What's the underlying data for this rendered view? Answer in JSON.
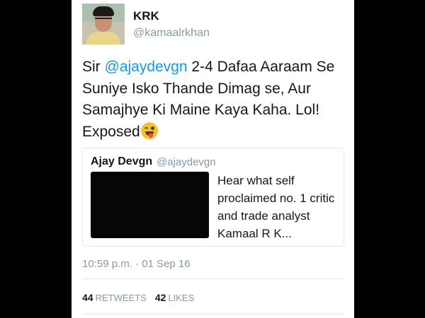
{
  "author": {
    "name": "KRK",
    "handle": "@kamaalrkhan"
  },
  "tweet": {
    "text_prefix": "Sir ",
    "mention": "@ajaydevgn",
    "text_suffix": " 2-4 Dafaa Aaraam Se Suniye Isko Thande Dimag se, Aur Samajhye Ki Maine Kaya Kaha. Lol! Exposed",
    "emoji": "winking-face-with-tongue-icon",
    "mention_color": "#1b95e0"
  },
  "quoted_tweet": {
    "name": "Ajay Devgn",
    "handle": "@ajaydevgn",
    "text": "Hear what self proclaimed no. 1 critic and trade analyst Kamaal R K..."
  },
  "timestamp": "10:59 p.m. · 01 Sep 16",
  "stats": {
    "retweets_count": "44",
    "retweets_label": "RETWEETS",
    "likes_count": "42",
    "likes_label": "LIKES"
  }
}
